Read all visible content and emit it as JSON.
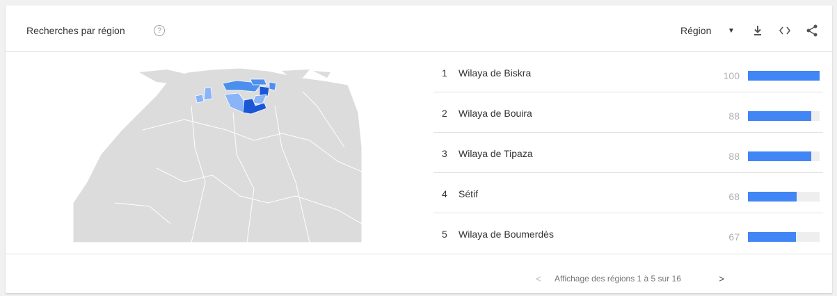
{
  "header": {
    "title": "Recherches par région",
    "help_glyph": "?",
    "region_select_label": "Région",
    "caret_glyph": "▼",
    "icons": [
      "question-circle-icon",
      "caret-down-icon",
      "download-icon",
      "embed-code-icon",
      "share-icon"
    ]
  },
  "colors": {
    "bar": "#4285f4",
    "bar_track": "#eeeeee",
    "map_land": "#dcdcdc",
    "map_highlight_dark": "#1a56d6",
    "map_highlight_mid": "#4d8fee",
    "map_highlight_light": "#8ab4f8"
  },
  "regions": [
    {
      "rank": "1",
      "name": "Wilaya de Biskra",
      "value": "100",
      "fraction": 1.0
    },
    {
      "rank": "2",
      "name": "Wilaya de Bouira",
      "value": "88",
      "fraction": 0.88
    },
    {
      "rank": "3",
      "name": "Wilaya de Tipaza",
      "value": "88",
      "fraction": 0.88
    },
    {
      "rank": "4",
      "name": "Sétif",
      "value": "68",
      "fraction": 0.68
    },
    {
      "rank": "5",
      "name": "Wilaya de Boumerdès",
      "value": "67",
      "fraction": 0.67
    }
  ],
  "pagination": {
    "prev_glyph": "<",
    "text": "Affichage des régions 1 à 5 sur 16",
    "next_glyph": ">"
  }
}
